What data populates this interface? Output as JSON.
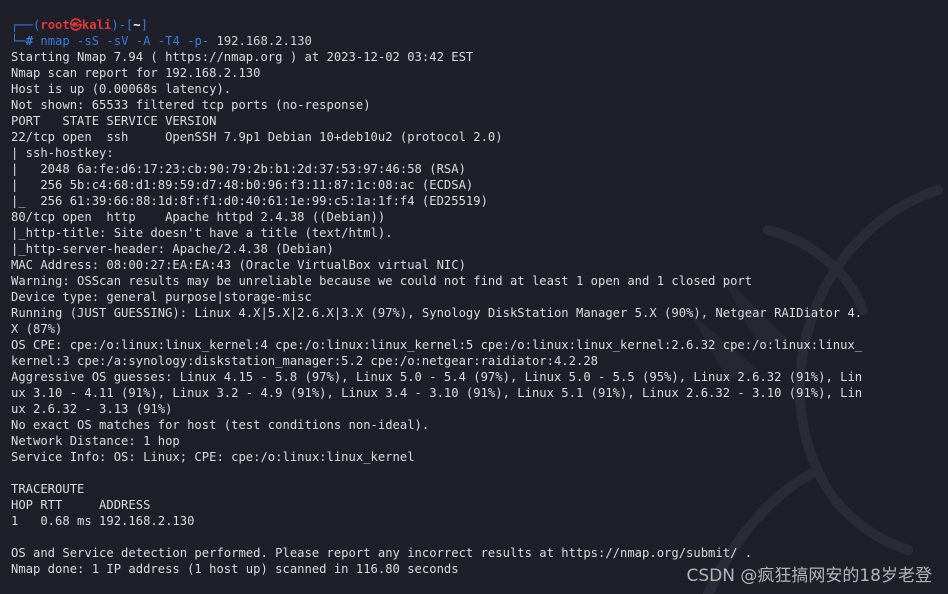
{
  "prompt": {
    "frame_open": "┌──(",
    "user": "root㉿kali",
    "frame_mid": ")-[",
    "dir": "~",
    "frame_close": "]",
    "frame_cmd": "└─",
    "hash": "# ",
    "command": "nmap -sS -sV -A -T4 -p- ",
    "target": "192.168.2.130"
  },
  "output": [
    "Starting Nmap 7.94 ( https://nmap.org ) at 2023-12-02 03:42 EST",
    "Nmap scan report for 192.168.2.130",
    "Host is up (0.00068s latency).",
    "Not shown: 65533 filtered tcp ports (no-response)",
    "PORT   STATE SERVICE VERSION",
    "22/tcp open  ssh     OpenSSH 7.9p1 Debian 10+deb10u2 (protocol 2.0)",
    "| ssh-hostkey: ",
    "|   2048 6a:fe:d6:17:23:cb:90:79:2b:b1:2d:37:53:97:46:58 (RSA)",
    "|   256 5b:c4:68:d1:89:59:d7:48:b0:96:f3:11:87:1c:08:ac (ECDSA)",
    "|_  256 61:39:66:88:1d:8f:f1:d0:40:61:1e:99:c5:1a:1f:f4 (ED25519)",
    "80/tcp open  http    Apache httpd 2.4.38 ((Debian))",
    "|_http-title: Site doesn't have a title (text/html).",
    "|_http-server-header: Apache/2.4.38 (Debian)",
    "MAC Address: 08:00:27:EA:EA:43 (Oracle VirtualBox virtual NIC)",
    "Warning: OSScan results may be unreliable because we could not find at least 1 open and 1 closed port",
    "Device type: general purpose|storage-misc",
    "Running (JUST GUESSING): Linux 4.X|5.X|2.6.X|3.X (97%), Synology DiskStation Manager 5.X (90%), Netgear RAIDiator 4.",
    "X (87%)",
    "OS CPE: cpe:/o:linux:linux_kernel:4 cpe:/o:linux:linux_kernel:5 cpe:/o:linux:linux_kernel:2.6.32 cpe:/o:linux:linux_",
    "kernel:3 cpe:/a:synology:diskstation_manager:5.2 cpe:/o:netgear:raidiator:4.2.28",
    "Aggressive OS guesses: Linux 4.15 - 5.8 (97%), Linux 5.0 - 5.4 (97%), Linux 5.0 - 5.5 (95%), Linux 2.6.32 (91%), Lin",
    "ux 3.10 - 4.11 (91%), Linux 3.2 - 4.9 (91%), Linux 3.4 - 3.10 (91%), Linux 5.1 (91%), Linux 2.6.32 - 3.10 (91%), Lin",
    "ux 2.6.32 - 3.13 (91%)",
    "No exact OS matches for host (test conditions non-ideal).",
    "Network Distance: 1 hop",
    "Service Info: OS: Linux; CPE: cpe:/o:linux:linux_kernel",
    "",
    "TRACEROUTE",
    "HOP RTT     ADDRESS",
    "1   0.68 ms 192.168.2.130",
    "",
    "OS and Service detection performed. Please report any incorrect results at https://nmap.org/submit/ .",
    "Nmap done: 1 IP address (1 host up) scanned in 116.80 seconds"
  ],
  "watermark": "CSDN @疯狂搞网安的18岁老登",
  "colors": {
    "background": "#1e1f29",
    "prompt_blue": "#3b7bd9",
    "prompt_red": "#e0383d",
    "text": "#dcdcdc"
  }
}
